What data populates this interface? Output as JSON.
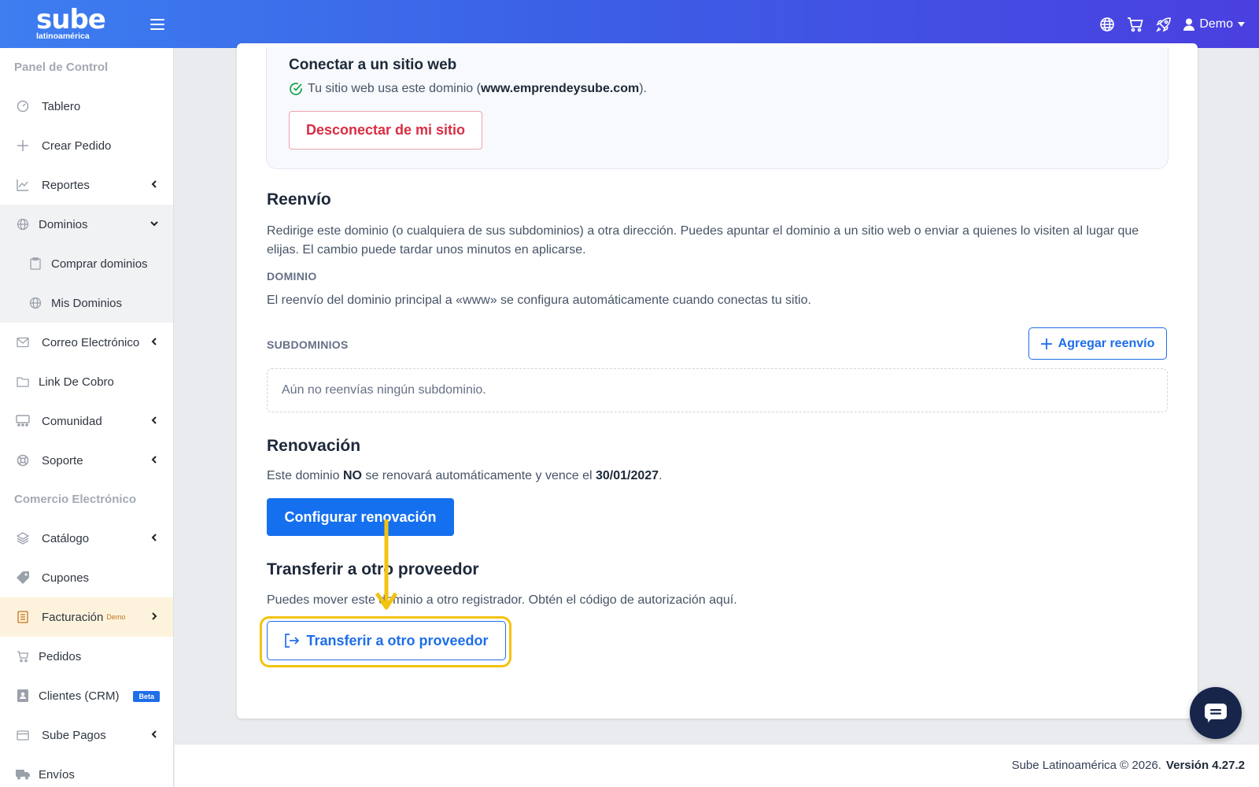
{
  "header": {
    "logo_main": "sube",
    "logo_sub": "latinoamérica",
    "user_name": "Demo"
  },
  "sidebar": {
    "section1": "Panel de Control",
    "section2": "Comercio Electrónico",
    "items": [
      {
        "label": "Tablero"
      },
      {
        "label": "Crear Pedido"
      },
      {
        "label": "Reportes"
      },
      {
        "label": "Dominios"
      },
      {
        "label": "Comprar dominios"
      },
      {
        "label": "Mis Dominios"
      },
      {
        "label": "Correo Electrónico"
      },
      {
        "label": "Link De Cobro"
      },
      {
        "label": "Comunidad"
      },
      {
        "label": "Soporte"
      },
      {
        "label": "Catálogo"
      },
      {
        "label": "Cupones"
      },
      {
        "label": "Facturación",
        "badge": "Demo"
      },
      {
        "label": "Pedidos"
      },
      {
        "label": "Clientes (CRM)",
        "badge": "Beta"
      },
      {
        "label": "Sube Pagos"
      },
      {
        "label": "Envíos"
      }
    ]
  },
  "connect": {
    "title": "Conectar a un sitio web",
    "text_before": "Tu sitio web usa este dominio (",
    "domain": "www.emprendeysube.com",
    "text_after": ").",
    "disconnect_label": "Desconectar de mi sitio"
  },
  "forwarding": {
    "title": "Reenvío",
    "description": "Redirige este dominio (o cualquiera de sus subdominios) a otra dirección. Puedes apuntar el dominio a un sitio web o enviar a quienes lo visiten al lugar que elijas. El cambio puede tardar unos minutos en aplicarse.",
    "domain_label": "DOMINIO",
    "domain_note": "El reenvío del dominio principal a «www» se configura automáticamente cuando conectas tu sitio.",
    "subdomains_label": "SUBDOMINIOS",
    "add_label": "Agregar reenvío",
    "empty_text": "Aún no reenvías ningún subdominio."
  },
  "renewal": {
    "title": "Renovación",
    "text_before": "Este dominio ",
    "no": "NO",
    "text_mid": " se renovará automáticamente y vence el ",
    "date": "30/01/2027",
    "text_after": ".",
    "button_label": "Configurar renovación"
  },
  "transfer": {
    "title": "Transferir a otro proveedor",
    "description": "Puedes mover este dominio a otro registrador. Obtén el código de autorización aquí.",
    "button_label": "Transferir a otro proveedor"
  },
  "footer": {
    "copyright": "Sube Latinoamérica © 2026.",
    "version": "Versión 4.27.2"
  },
  "colors": {
    "primary": "#1570ef",
    "danger": "#d92d42",
    "highlight": "#f4c30f",
    "active_bg": "#fdf3dd"
  }
}
